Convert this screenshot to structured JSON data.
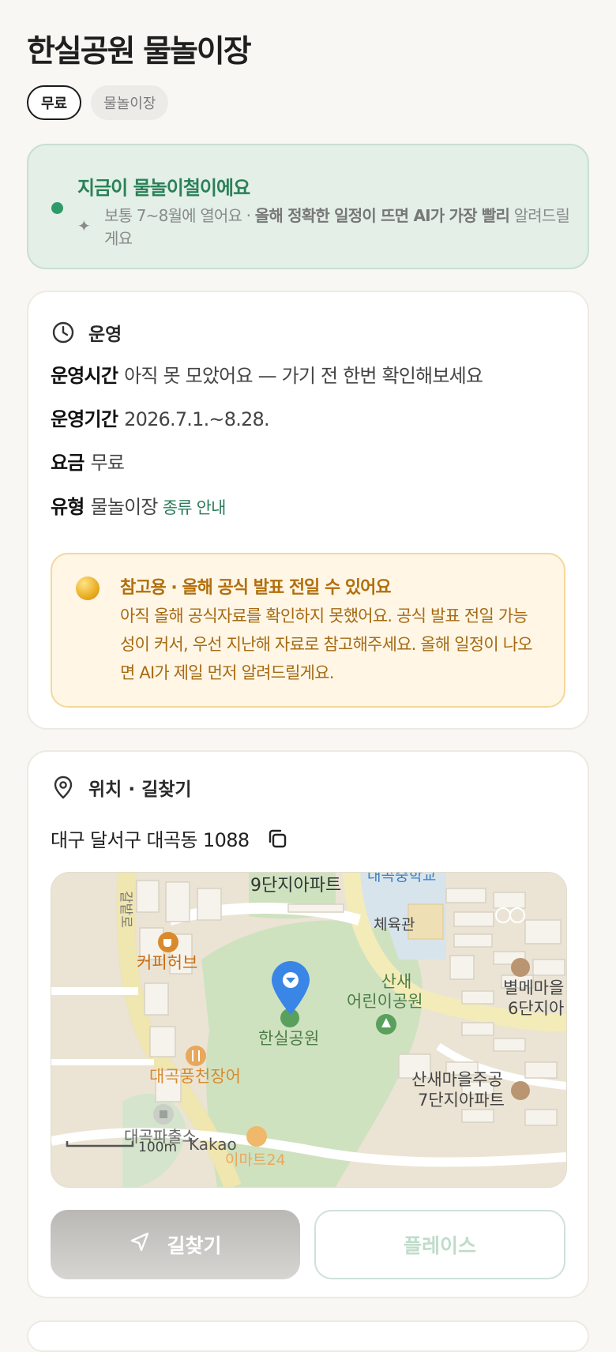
{
  "title": "한실공원 물놀이장",
  "chips": {
    "active": "무료",
    "muted": "물놀이장"
  },
  "banner": {
    "title": "지금이 물놀이철이에요",
    "text_plain": "보통 7~8월에 열어요 · ",
    "text_bold": "올해 정확한 일정이 뜨면 AI가 가장 빨리",
    "text_tail": " 알려드릴게요",
    "icon": "sparkle-icon",
    "accent": "#2f9a69"
  },
  "operation": {
    "heading": "운영",
    "icon": "clock-icon",
    "rows": [
      {
        "key": "운영시간",
        "value": "아직 못 모았어요 — 가기 전 한번 확인해보세요"
      },
      {
        "key": "운영기간",
        "value": "2026.7.1.~8.28."
      },
      {
        "key": "요금",
        "value": "무료"
      },
      {
        "key": "유형",
        "value": "물놀이장",
        "link": "종류 안내"
      }
    ],
    "notice": {
      "icon": "moon-icon",
      "title": "참고용 · 올해 공식 발표 전일 수 있어요",
      "text": "아직 올해 공식자료를 확인하지 못했어요. 공식 발표 전일 가능성이 커서, 우선 지난해 자료로 참고해주세요. 올해 일정이 나오면 AI가 제일 먼저 알려드릴게요."
    }
  },
  "location": {
    "heading": "위치 · 길찾기",
    "icon": "location-pin-icon",
    "address": "대구 달서구 대곡동 1088",
    "copy_icon": "copy-icon",
    "map": {
      "labels": {
        "apt9": "9단지아파트",
        "school": "대곡중학교",
        "gym": "체육관",
        "road": "갈밭로",
        "cafe": "커피허브",
        "park": "한실공원",
        "playground_1": "산새",
        "playground_2": "어린이공원",
        "byeol_1": "별메마을",
        "byeol_2": "6단지아",
        "restaurant": "대곡풍천장어",
        "apt7_1": "산새마을주공",
        "apt7_2": "7단지아파트",
        "police": "대곡파출소",
        "scale": "100m",
        "brand": "Kakao",
        "mart": "이마트24"
      }
    },
    "route_button": "길찾기",
    "place_button": "플레이스"
  }
}
